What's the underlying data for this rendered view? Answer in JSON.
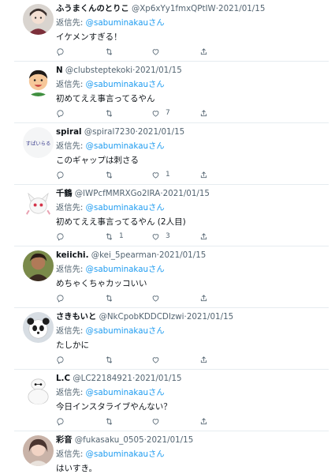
{
  "tweets": [
    {
      "name": "ふうまくんのとりこ",
      "handle": "@Xp6xYy1fmxQPtIW",
      "date": "2021/01/15",
      "reply_prefix": "返信先:",
      "reply_to": "@sabuminakau",
      "reply_suffix": "さん",
      "text": "イケメンすぎる！",
      "reply_count": "",
      "retweet_count": "",
      "like_count": "",
      "avatar": "girl-avatar"
    },
    {
      "name": "N",
      "handle": "@clubsteptekoki",
      "date": "2021/01/15",
      "reply_prefix": "返信先:",
      "reply_to": "@sabuminakau",
      "reply_suffix": "さん",
      "text": "初めてええ事言ってるやん",
      "reply_count": "",
      "retweet_count": "",
      "like_count": "7",
      "avatar": "cartoon-boy-avatar"
    },
    {
      "name": "spiral",
      "handle": "@spiral7230",
      "date": "2021/01/15",
      "reply_prefix": "返信先:",
      "reply_to": "@sabuminakau",
      "reply_suffix": "さん",
      "text": "このギャップは刺さる",
      "reply_count": "",
      "retweet_count": "",
      "like_count": "1",
      "avatar": "handwritten-avatar",
      "avatar_text": "すぱいらる"
    },
    {
      "name": "千鶴",
      "handle": "@lWPcfMMRXGo2IRA",
      "date": "2021/01/15",
      "reply_prefix": "返信先:",
      "reply_to": "@sabuminakau",
      "reply_suffix": "さん",
      "text": "初めてええ事言ってるやん (2人目)",
      "reply_count": "",
      "retweet_count": "1",
      "like_count": "3",
      "avatar": "white-creature-avatar"
    },
    {
      "name": "keiichi.",
      "handle": "@kei_5pearman",
      "date": "2021/01/15",
      "reply_prefix": "返信先:",
      "reply_to": "@sabuminakau",
      "reply_suffix": "さん",
      "text": "めちゃくちゃカッコいい",
      "reply_count": "",
      "retweet_count": "",
      "like_count": "",
      "avatar": "person-avatar"
    },
    {
      "name": "さきもいと",
      "handle": "@NkCpobKDDCDIzwi",
      "date": "2021/01/15",
      "reply_prefix": "返信先:",
      "reply_to": "@sabuminakau",
      "reply_suffix": "さん",
      "text": "たしかに",
      "reply_count": "",
      "retweet_count": "",
      "like_count": "",
      "avatar": "panda-avatar"
    },
    {
      "name": "L.C",
      "handle": "@LC22184921",
      "date": "2021/01/15",
      "reply_prefix": "返信先:",
      "reply_to": "@sabuminakau",
      "reply_suffix": "さん",
      "text": "今日インスタライブやんない？",
      "reply_count": "",
      "retweet_count": "",
      "like_count": "",
      "avatar": "robot-avatar"
    },
    {
      "name": "彩音",
      "handle": "@fukasaku_0505",
      "date": "2021/01/15",
      "reply_prefix": "返信先:",
      "reply_to": "@sabuminakau",
      "reply_suffix": "さん",
      "text": "はいすき。",
      "reply_count": "",
      "retweet_count": "",
      "like_count": "",
      "avatar": "photo-avatar"
    }
  ],
  "colors": {
    "accent": "#1d9bf0",
    "muted": "#536471",
    "text": "#0f1419",
    "divider": "#e6ecf0"
  }
}
